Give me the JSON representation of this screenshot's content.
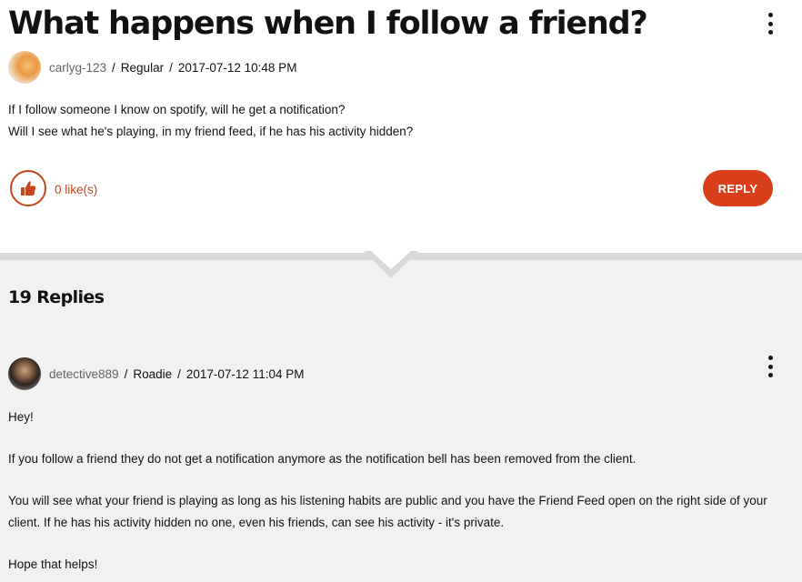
{
  "post": {
    "title": "What happens when I follow a friend?",
    "author": {
      "username": "carlyg-123",
      "rank": "Regular",
      "timestamp": "2017-07-12 10:48 PM",
      "separator": "/"
    },
    "body_lines": [
      "If I follow someone I know on spotify, will he get a notification?",
      "Will I see what he's playing, in my friend feed, if he has his activity hidden?"
    ],
    "likes_label": "0 like(s)",
    "reply_label": "REPLY",
    "like_icon": "thumbs-up-icon",
    "menu_icon": "more-options-icon"
  },
  "replies": {
    "heading": "19 Replies",
    "items": [
      {
        "username": "detective889",
        "rank": "Roadie",
        "timestamp": "2017-07-12 11:04 PM",
        "separator": "/",
        "paragraphs": [
          "Hey!",
          "If you follow a friend they do not get a notification anymore as the notification bell has been removed from the client.",
          "You will see what your friend is playing as long as his listening habits are public and you have the Friend Feed open on the right side of your client. If he has his activity hidden no one, even his friends, can see his activity - it's private.",
          "Hope that helps!"
        ]
      }
    ]
  },
  "colors": {
    "accent": "#d7401b",
    "like_outline": "#c8441b",
    "replies_background": "#f1f1f1",
    "username_gray": "#656565"
  }
}
